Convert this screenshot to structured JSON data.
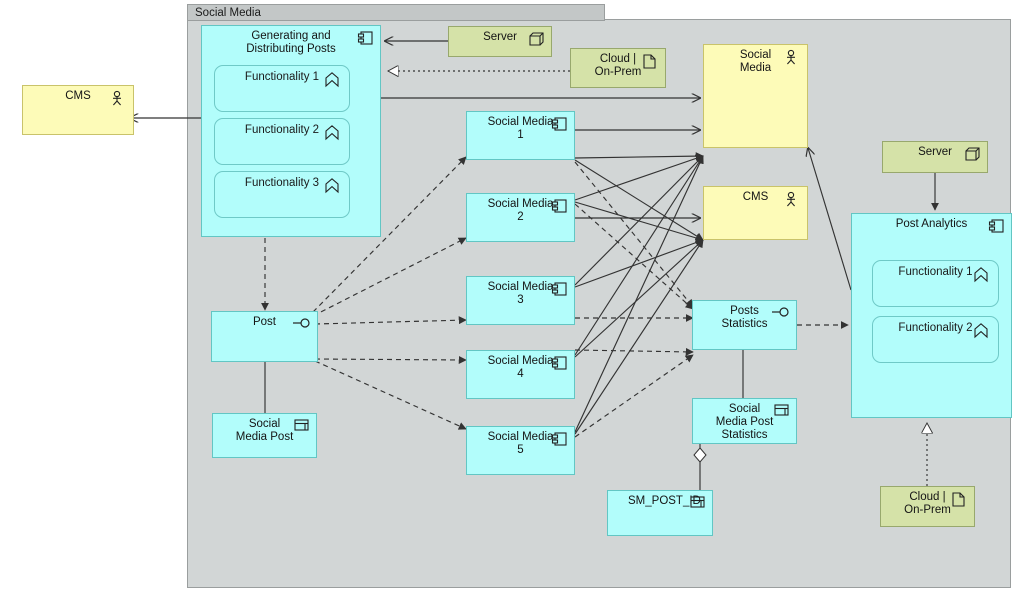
{
  "diagram": {
    "type": "uml-component-deployment-diagram",
    "frame_label": "Social Media",
    "colors": {
      "canvas": "#ffffff",
      "frame_fill": "#d2d6d6",
      "frame_tab_fill": "#c3c7c7",
      "frame_border": "#9a9e9e",
      "component_fill": "#b2fdfb",
      "component_border": "#62c6c4",
      "actor_fill": "#fdfbb8",
      "actor_border": "#c9c36a",
      "node_fill": "#d5e2a8",
      "node_border": "#98a86d",
      "edge": "#333333"
    }
  },
  "nodes": {
    "cms_external": {
      "label": "CMS",
      "icon": "actor-icon",
      "kind": "actor"
    },
    "generating_posts": {
      "label": "Generating and Distributing Posts",
      "icon": "component-icon",
      "kind": "component"
    },
    "gp_func1": {
      "label": "Functionality 1",
      "icon": "feature-icon"
    },
    "gp_func2": {
      "label": "Functionality 2",
      "icon": "feature-icon"
    },
    "gp_func3": {
      "label": "Functionality 3",
      "icon": "feature-icon"
    },
    "server_top": {
      "label": "Server",
      "icon": "node-icon",
      "kind": "node"
    },
    "cloud_onprem_top": {
      "label": "Cloud | On-Prem",
      "icon": "document-icon",
      "kind": "artifact"
    },
    "social_media_actor": {
      "label": "Social Media",
      "icon": "actor-icon",
      "kind": "actor"
    },
    "cms_actor": {
      "label": "CMS",
      "icon": "actor-icon",
      "kind": "actor"
    },
    "social_media_1": {
      "label": "Social Media 1",
      "icon": "component-icon",
      "kind": "component"
    },
    "social_media_2": {
      "label": "Social Media 2",
      "icon": "component-icon",
      "kind": "component"
    },
    "social_media_3": {
      "label": "Social Media 3",
      "icon": "component-icon",
      "kind": "component"
    },
    "social_media_4": {
      "label": "Social Media 4",
      "icon": "component-icon",
      "kind": "component"
    },
    "social_media_5": {
      "label": "Social Media 5",
      "icon": "component-icon",
      "kind": "component"
    },
    "post": {
      "label": "Post",
      "icon": "provided-interface-icon",
      "kind": "component"
    },
    "social_media_post": {
      "label": "Social Media Post",
      "icon": "table-icon",
      "kind": "table"
    },
    "posts_statistics": {
      "label": "Posts Statistics",
      "icon": "provided-interface-icon",
      "kind": "component"
    },
    "social_media_post_statistics": {
      "label": "Social Media Post Statistics",
      "icon": "table-icon",
      "kind": "table"
    },
    "sm_post_id": {
      "label": "SM_POST_ID",
      "icon": "table-icon",
      "kind": "table"
    },
    "server_right": {
      "label": "Server",
      "icon": "node-icon",
      "kind": "node"
    },
    "post_analytics": {
      "label": "Post Analytics",
      "icon": "component-icon",
      "kind": "component"
    },
    "pa_func1": {
      "label": "Functionality 1",
      "icon": "feature-icon"
    },
    "pa_func2": {
      "label": "Functionality 2",
      "icon": "feature-icon"
    },
    "cloud_onprem_bottom": {
      "label": "Cloud | On-Prem",
      "icon": "document-icon",
      "kind": "artifact"
    }
  }
}
